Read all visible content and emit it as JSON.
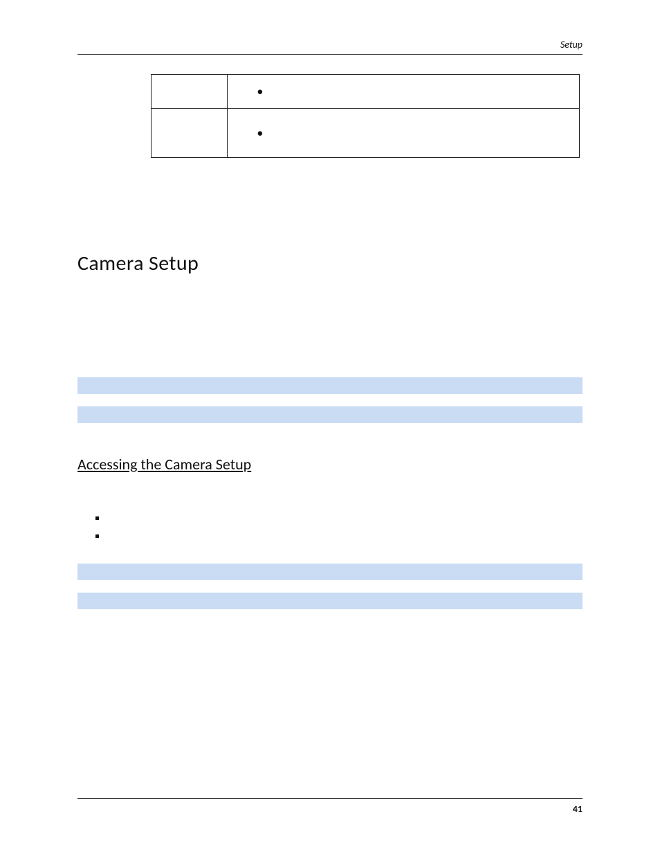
{
  "header": {
    "section": "Setup"
  },
  "table": {
    "rows": [
      {
        "label": "",
        "content": ""
      },
      {
        "label": "",
        "content": ""
      }
    ]
  },
  "headings": {
    "h1": "Camera Setup",
    "h2": "Accessing the Camera Setup"
  },
  "notes_top": [
    "",
    ""
  ],
  "list_items": [
    "",
    ""
  ],
  "notes_mid": [
    "",
    ""
  ],
  "footer": {
    "page_number": "41"
  }
}
